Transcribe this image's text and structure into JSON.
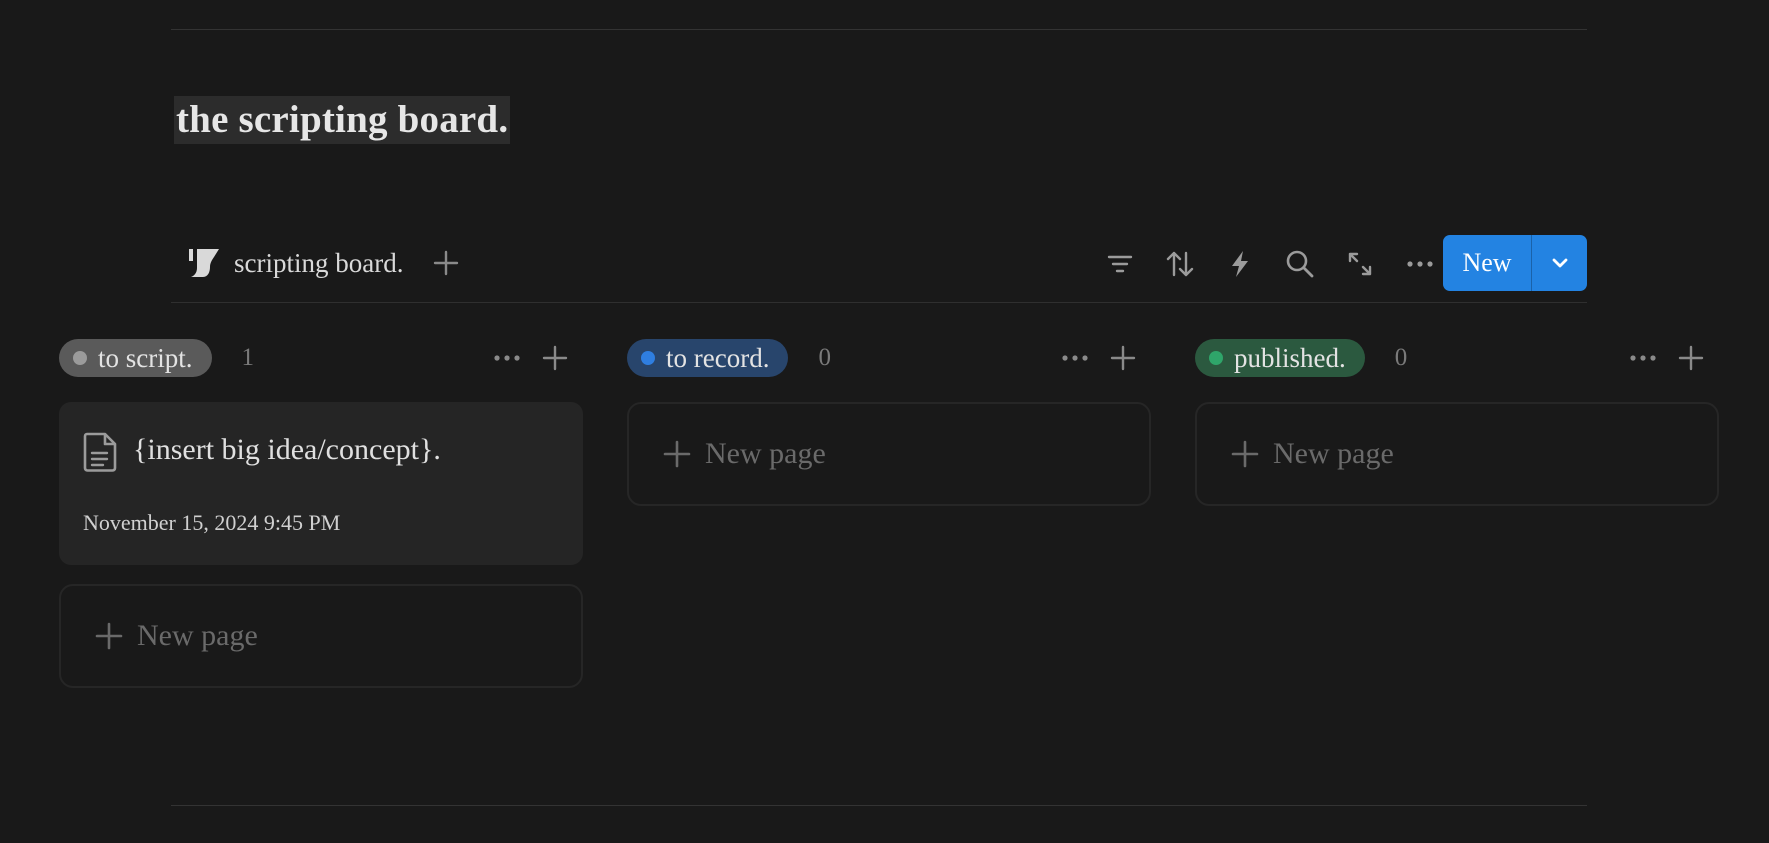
{
  "page": {
    "title": "the scripting board."
  },
  "view": {
    "icon": "script-icon",
    "label": "scripting board.",
    "add_icon": "plus-icon"
  },
  "toolbar": {
    "tools": [
      "filter-icon",
      "sort-icon",
      "automation-bolt-icon",
      "search-icon",
      "expand-icon",
      "more-icon"
    ],
    "new_label": "New",
    "new_caret_icon": "chevron-down-icon",
    "accent_color": "#2383e2"
  },
  "columns": [
    {
      "status": "to script.",
      "count": "1",
      "pill_bg": "#5a5a5a",
      "dot_color": "#9b9b9b",
      "cards": [
        {
          "title": "{insert big idea/concept}.",
          "date": "November 15, 2024 9:45 PM",
          "icon": "document-icon"
        }
      ],
      "new_page_label": "New page"
    },
    {
      "status": "to record.",
      "count": "0",
      "pill_bg": "#28456c",
      "dot_color": "#2f7ee0",
      "cards": [],
      "new_page_label": "New page"
    },
    {
      "status": "published.",
      "count": "0",
      "pill_bg": "#2b593f",
      "dot_color": "#2fa56a",
      "cards": [],
      "new_page_label": "New page"
    }
  ]
}
